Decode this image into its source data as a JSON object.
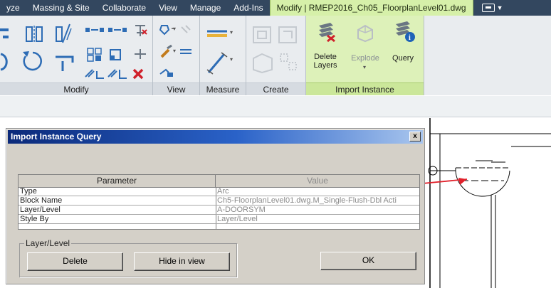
{
  "ribbon_tabs": {
    "items": [
      "yze",
      "Massing & Site",
      "Collaborate",
      "View",
      "Manage",
      "Add-Ins"
    ],
    "active_tab": "Modify | RMEP2016_Ch05_FloorplanLevel01.dwg",
    "dropdown_icon": "window-dropdown-icon"
  },
  "panels": {
    "modify": "Modify",
    "view": "View",
    "measure": "Measure",
    "create": "Create",
    "import_instance": "Import Instance"
  },
  "commands": {
    "delete_layers_line1": "Delete",
    "delete_layers_line2": "Layers",
    "explode": "Explode",
    "query": "Query"
  },
  "dialog": {
    "title": "Import Instance Query",
    "close": "x",
    "table": {
      "headers": {
        "parameter": "Parameter",
        "value": "Value"
      },
      "rows": [
        {
          "parameter": "Type",
          "value": "Arc"
        },
        {
          "parameter": "Block Name",
          "value": "Ch5-FloorplanLevel01.dwg.M_Single-Flush-Dbl Acti"
        },
        {
          "parameter": "Layer/Level",
          "value": "A-DOORSYM"
        },
        {
          "parameter": "Style By",
          "value": "Layer/Level"
        }
      ]
    },
    "group_label": "Layer/Level",
    "buttons": {
      "delete": "Delete",
      "hide_in_view": "Hide in view",
      "ok": "OK"
    }
  },
  "colors": {
    "ribbon_tab_bg": "#33475f",
    "active_tab_bg": "#d6f0a9",
    "import_panel_bg": "#ddf1b9",
    "dialog_title_start": "#0b2a7a",
    "annotation_arrow": "#e0212b",
    "icon_blue": "#2d6cb5"
  }
}
